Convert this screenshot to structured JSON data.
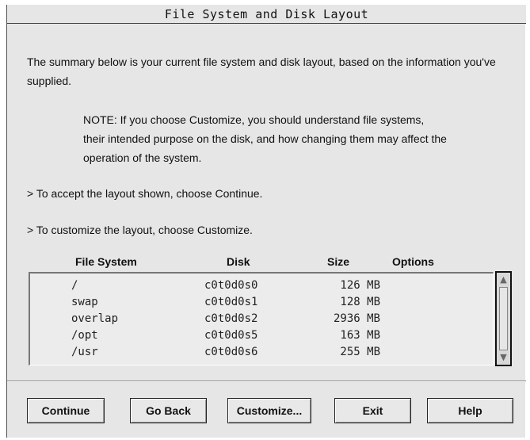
{
  "window": {
    "title": "File System and Disk Layout"
  },
  "text": {
    "intro": "The summary below is your current file system and disk layout, based on the information you've supplied.",
    "note": "NOTE: If you choose Customize, you should understand file systems, their intended purpose on the disk, and how changing them may affect the operation of the system.",
    "accept": "> To accept the layout shown, choose Continue.",
    "customize": "> To customize the layout, choose Customize."
  },
  "table": {
    "headers": {
      "file_system": "File System",
      "disk": "Disk",
      "size": "Size",
      "options": "Options"
    },
    "rows": [
      {
        "file_system": "/",
        "disk": "c0t0d0s0",
        "size": "126 MB"
      },
      {
        "file_system": "swap",
        "disk": "c0t0d0s1",
        "size": "128 MB"
      },
      {
        "file_system": "overlap",
        "disk": "c0t0d0s2",
        "size": "2936 MB"
      },
      {
        "file_system": "/opt",
        "disk": "c0t0d0s5",
        "size": "163 MB"
      },
      {
        "file_system": "/usr",
        "disk": "c0t0d0s6",
        "size": "255 MB"
      }
    ]
  },
  "buttons": {
    "continue": "Continue",
    "go_back": "Go Back",
    "customize": "Customize...",
    "exit": "Exit",
    "help": "Help"
  },
  "icons": {
    "scroll_up": "scroll-up-arrow-icon",
    "scroll_down": "scroll-down-arrow-icon"
  },
  "colors": {
    "background": "#e6e6e6",
    "list_background": "#ececec",
    "text": "#111111"
  }
}
